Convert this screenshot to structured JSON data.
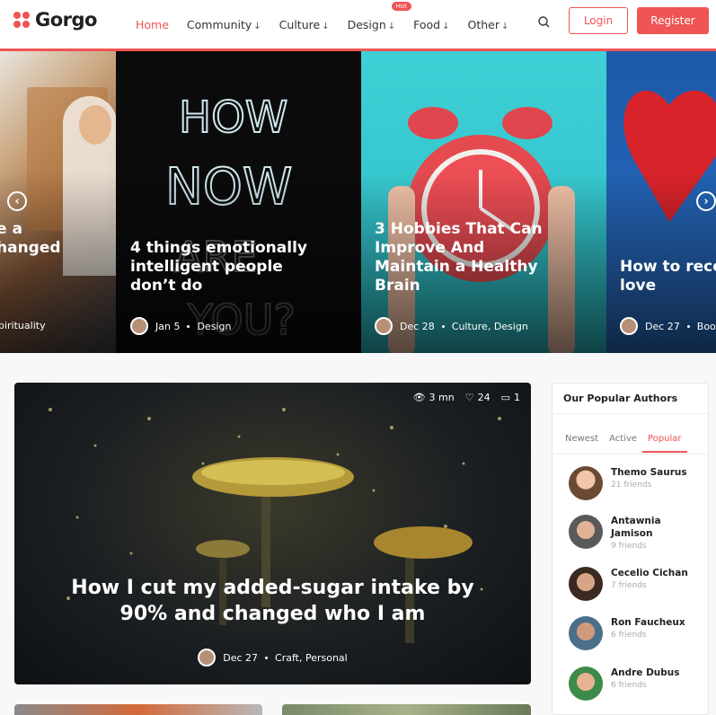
{
  "brand": {
    "name": "Gorgo",
    "accent": "#f05454"
  },
  "nav": {
    "items": [
      {
        "label": "Home",
        "arrow": "",
        "active": true
      },
      {
        "label": "Community",
        "arrow": "↓"
      },
      {
        "label": "Culture",
        "arrow": "↓"
      },
      {
        "label": "Design",
        "arrow": "↓",
        "badge": "Hot"
      },
      {
        "label": "Food",
        "arrow": "↓"
      },
      {
        "label": "Other",
        "arrow": "↓"
      }
    ],
    "search_icon": "search-icon",
    "login": "Login",
    "register": "Register"
  },
  "slider": {
    "slides": [
      {
        "title": "e a\nhanged",
        "date": "",
        "category": "pirituality"
      },
      {
        "title": "4 things emotionally\nintelligent people\ndon’t do",
        "date": "Jan 5",
        "category": "Design"
      },
      {
        "title": "3 Hobbies That Can\nImprove And\nMaintain a Healthy\nBrain",
        "date": "Dec 28",
        "category": "Culture, Design"
      },
      {
        "title": "How to recog\nlove",
        "date": "Dec 27",
        "category": "Boo"
      }
    ],
    "prev_icon": "arrow-left-circle-icon",
    "next_icon": "arrow-right-circle-icon"
  },
  "featured": {
    "read_time": "3 mn",
    "likes": "24",
    "comments": "1",
    "title": "How I cut my added-sugar intake by\n90% and changed who I am",
    "date": "Dec 27",
    "category": "Craft, Personal"
  },
  "authors": {
    "title": "Our Popular Authors",
    "tabs": [
      "Newest",
      "Active",
      "Popular"
    ],
    "active_tab": "Popular",
    "list": [
      {
        "name": "Themo Saurus",
        "friends": "21 friends"
      },
      {
        "name": "Antawnia\nJamison",
        "friends": "9 friends"
      },
      {
        "name": "Cecelio Cichan",
        "friends": "7 friends"
      },
      {
        "name": "Ron Faucheux",
        "friends": "6 friends"
      },
      {
        "name": "Andre Dubus",
        "friends": "6 friends"
      }
    ]
  }
}
